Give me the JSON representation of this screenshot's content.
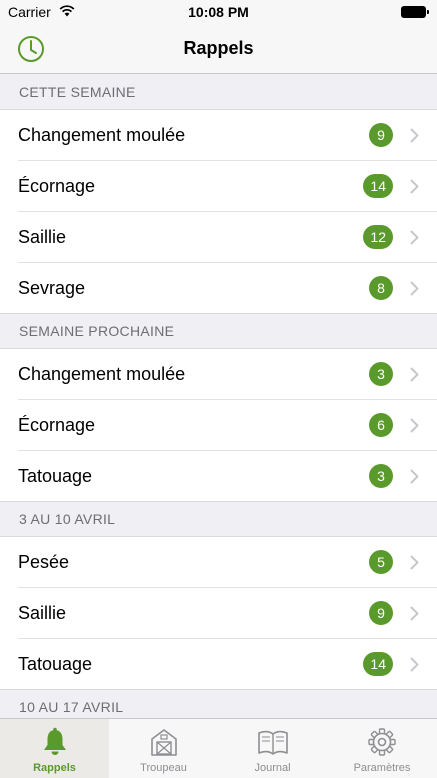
{
  "status_bar": {
    "carrier": "Carrier",
    "time": "10:08 PM"
  },
  "nav": {
    "title": "Rappels"
  },
  "colors": {
    "accent": "#5a9a2c",
    "badge": "#5a9a2c"
  },
  "sections": [
    {
      "header": "CETTE SEMAINE",
      "items": [
        {
          "label": "Changement moulée",
          "count": "9"
        },
        {
          "label": "Écornage",
          "count": "14"
        },
        {
          "label": "Saillie",
          "count": "12"
        },
        {
          "label": "Sevrage",
          "count": "8"
        }
      ]
    },
    {
      "header": "SEMAINE PROCHAINE",
      "items": [
        {
          "label": "Changement moulée",
          "count": "3"
        },
        {
          "label": "Écornage",
          "count": "6"
        },
        {
          "label": "Tatouage",
          "count": "3"
        }
      ]
    },
    {
      "header": "3 AU 10 AVRIL",
      "items": [
        {
          "label": "Pesée",
          "count": "5"
        },
        {
          "label": "Saillie",
          "count": "9"
        },
        {
          "label": "Tatouage",
          "count": "14"
        }
      ]
    },
    {
      "header": "10 AU 17 AVRIL",
      "items": []
    }
  ],
  "tabs": [
    {
      "label": "Rappels",
      "icon": "bell-icon",
      "active": true
    },
    {
      "label": "Troupeau",
      "icon": "barn-icon",
      "active": false
    },
    {
      "label": "Journal",
      "icon": "book-icon",
      "active": false
    },
    {
      "label": "Paramètres",
      "icon": "gear-icon",
      "active": false
    }
  ]
}
